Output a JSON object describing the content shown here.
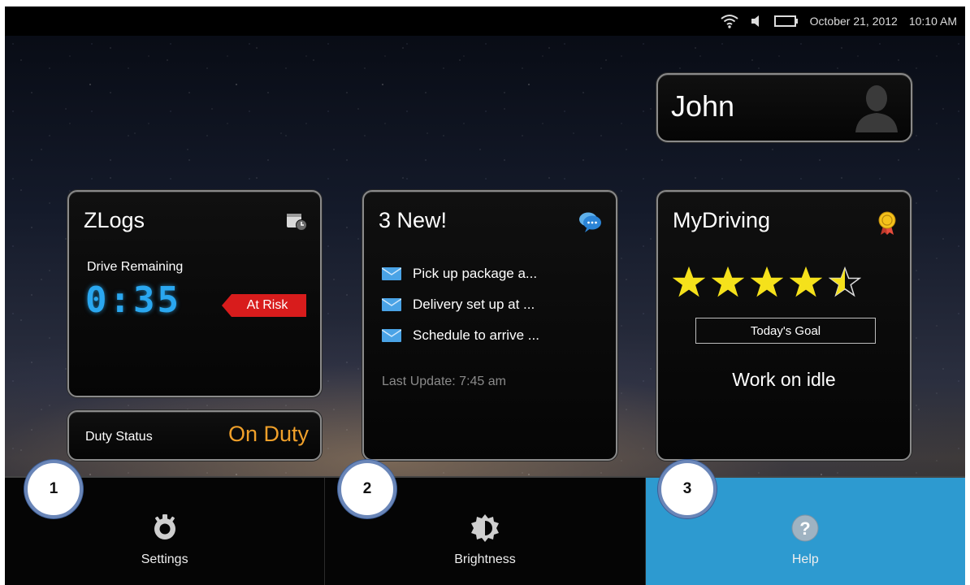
{
  "status_bar": {
    "date": "October 21, 2012",
    "time": "10:10 AM",
    "icons": [
      "wifi-icon",
      "speaker-icon",
      "battery-icon"
    ]
  },
  "user": {
    "name": "John",
    "icon": "user-silhouette-icon"
  },
  "zlogs": {
    "title": "ZLogs",
    "icon": "calendar-clock-icon",
    "drive_remaining_label": "Drive Remaining",
    "drive_remaining_value": "0:35",
    "risk_label": "At Risk"
  },
  "duty": {
    "label": "Duty Status",
    "value": "On Duty"
  },
  "messages": {
    "title": "3 New!",
    "icon": "chat-bubble-icon",
    "items": [
      {
        "text": "Pick up package a..."
      },
      {
        "text": "Delivery set up at ..."
      },
      {
        "text": "Schedule to arrive ..."
      }
    ],
    "last_update": "Last Update: 7:45 am"
  },
  "mydriving": {
    "title": "MyDriving",
    "icon": "award-medal-icon",
    "rating": 4.5,
    "rating_max": 5,
    "goal_label": "Today's Goal",
    "goal_text": "Work on idle"
  },
  "bottom_tabs": [
    {
      "label": "Settings",
      "icon": "gear-icon",
      "callout": "1"
    },
    {
      "label": "Brightness",
      "icon": "brightness-icon",
      "callout": "2"
    },
    {
      "label": "Help",
      "icon": "help-icon",
      "callout": "3"
    }
  ],
  "colors": {
    "accent_blue": "#2d9ad0",
    "clock_blue": "#2aa7f0",
    "duty_orange": "#f0a02a",
    "risk_red": "#d81c1c",
    "star_yellow": "#f5e11b",
    "callout_border": "#6a86b8"
  }
}
